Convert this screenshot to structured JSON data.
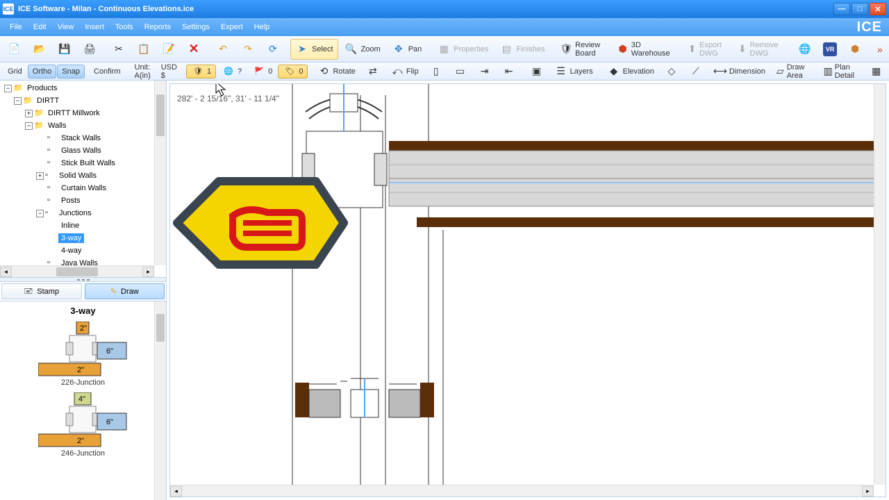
{
  "titlebar": {
    "app": "ICE",
    "title": "ICE Software - Milan - Continuous Elevations.ice"
  },
  "menu": [
    "File",
    "Edit",
    "View",
    "Insert",
    "Tools",
    "Reports",
    "Settings",
    "Expert",
    "Help"
  ],
  "logo": "ICE",
  "toolbar1": {
    "select": "Select",
    "zoom": "Zoom",
    "pan": "Pan",
    "properties": "Properties",
    "finishes": "Finishes",
    "review": "Review Board",
    "warehouse": "3D Warehouse",
    "exportdwg": "Export DWG",
    "removedwg": "Remove DWG"
  },
  "toolbar2": {
    "grid": "Grid",
    "ortho": "Ortho",
    "snap": "Snap",
    "confirm": "Confirm",
    "unit": "Unit: A(in)",
    "currency": "USD $",
    "n1": "1",
    "q": "?",
    "n0": "0",
    "n02": "0",
    "rotate": "Rotate",
    "flip": "Flip",
    "layers": "Layers",
    "elevation": "Elevation",
    "dimension": "Dimension",
    "drawarea": "Draw Area",
    "plandetail": "Plan Detail"
  },
  "tree": {
    "root": "Products",
    "dirtt": "DIRTT",
    "millwork": "DIRTT Millwork",
    "walls": "Walls",
    "stack": "Stack Walls",
    "glass": "Glass Walls",
    "stick": "Stick Built Walls",
    "solid": "Solid Walls",
    "curtain": "Curtain Walls",
    "posts": "Posts",
    "junctions": "Junctions",
    "inline": "Inline",
    "threeway": "3-way",
    "fourway": "4-way",
    "java": "Java Walls"
  },
  "mode": {
    "stamp": "Stamp",
    "draw": "Draw"
  },
  "preview": {
    "title": "3-way",
    "j1": {
      "label": "226-Junction",
      "dim2": "2\"",
      "dim6": "6\""
    },
    "j2": {
      "label": "246-Junction",
      "dim4": "4\"",
      "dim2": "2\"",
      "dim6": "6\""
    }
  },
  "canvas": {
    "coord": "282' - 2 15/16\", 31' - 11 1/4\""
  }
}
